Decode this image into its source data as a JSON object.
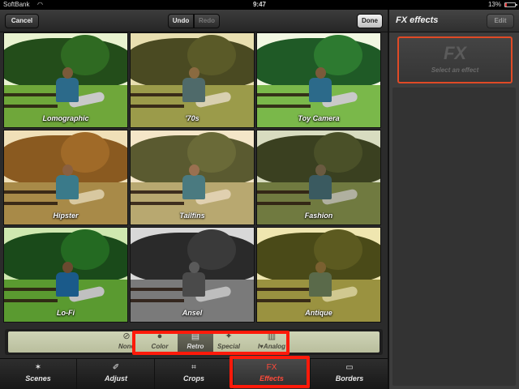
{
  "status_bar": {
    "carrier": "SoftBank",
    "time": "9:47",
    "battery": "13%",
    "battery_level": 0.13
  },
  "toolbar": {
    "cancel_label": "Cancel",
    "undo_label": "Undo",
    "redo_label": "Redo",
    "done_label": "Done"
  },
  "effects": [
    {
      "label": "Lomographic",
      "filter": "lomo"
    },
    {
      "label": "'70s",
      "filter": "seventies"
    },
    {
      "label": "Toy Camera",
      "filter": "toy"
    },
    {
      "label": "Hipster",
      "filter": "hipster"
    },
    {
      "label": "Tailfins",
      "filter": "tailfins"
    },
    {
      "label": "Fashion",
      "filter": "fashion"
    },
    {
      "label": "Lo-Fi",
      "filter": "lofi"
    },
    {
      "label": "Ansel",
      "filter": "ansel"
    },
    {
      "label": "Antique",
      "filter": "antique"
    }
  ],
  "categories": [
    {
      "label": "None",
      "icon": "none-icon",
      "glyph": "⊘"
    },
    {
      "label": "Color",
      "icon": "color-icon",
      "glyph": "●"
    },
    {
      "label": "Retro",
      "icon": "retro-icon",
      "glyph": "▤",
      "selected": true
    },
    {
      "label": "Special",
      "icon": "special-icon",
      "glyph": "✦"
    },
    {
      "label": "I♥Analog",
      "icon": "film-icon",
      "glyph": "▥"
    }
  ],
  "tabs": [
    {
      "label": "Scenes",
      "icon": "scenes-icon",
      "glyph": "✶"
    },
    {
      "label": "Adjust",
      "icon": "adjust-icon",
      "glyph": "✐"
    },
    {
      "label": "Crops",
      "icon": "crop-icon",
      "glyph": "⌗"
    },
    {
      "label": "Effects",
      "icon": "fx-icon",
      "glyph": "FX",
      "active": true
    },
    {
      "label": "Borders",
      "icon": "borders-icon",
      "glyph": "▭"
    }
  ],
  "side_panel": {
    "title": "FX effects",
    "edit_label": "Edit",
    "slot_logo": "FX",
    "slot_hint": "Select an effect"
  },
  "colors": {
    "highlight": "#ff1a0a",
    "active_tab": "#ff4a3a",
    "slot_border": "#e04a26"
  }
}
